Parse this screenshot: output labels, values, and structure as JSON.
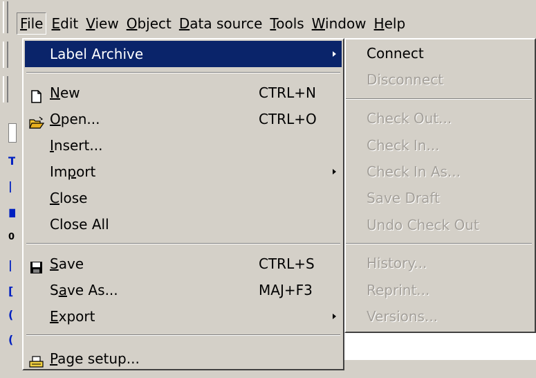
{
  "menubar": {
    "items": [
      {
        "mnemonic": "F",
        "rest": "ile"
      },
      {
        "mnemonic": "E",
        "rest": "dit"
      },
      {
        "mnemonic": "V",
        "rest": "iew"
      },
      {
        "mnemonic": "O",
        "rest": "bject"
      },
      {
        "mnemonic": "D",
        "rest": "ata source"
      },
      {
        "mnemonic": "T",
        "rest": "ools"
      },
      {
        "mnemonic": "W",
        "rest": "indow"
      },
      {
        "mnemonic": "H",
        "rest": "elp"
      }
    ]
  },
  "file_menu": {
    "items": [
      {
        "label": "Label Archive"
      },
      {
        "label_mn": "N",
        "label_rest": "ew",
        "shortcut": "CTRL+N",
        "icon": "new-page-icon"
      },
      {
        "label_mn": "O",
        "label_rest": "pen...",
        "shortcut": "CTRL+O",
        "icon": "open-folder-icon"
      },
      {
        "label_mn": "I",
        "label_rest": "nsert..."
      },
      {
        "label_pre": "Im",
        "label_mn": "p",
        "label_rest": "ort"
      },
      {
        "label_mn": "C",
        "label_rest": "lose"
      },
      {
        "label": "Close All"
      },
      {
        "label_mn": "S",
        "label_rest": "ave",
        "shortcut": "CTRL+S",
        "icon": "save-disk-icon"
      },
      {
        "label_pre": "S",
        "label_mn": "a",
        "label_rest": "ve As...",
        "shortcut": "MAJ+F3"
      },
      {
        "label_mn": "E",
        "label_rest": "xport"
      },
      {
        "label_mn": "P",
        "label_rest": "age setup...",
        "icon": "page-setup-icon"
      }
    ]
  },
  "archive_submenu": {
    "items": [
      {
        "label": "Connect",
        "enabled": true
      },
      {
        "label": "Disconnect",
        "enabled": false
      },
      {
        "label": "Check Out...",
        "enabled": false
      },
      {
        "label": "Check In...",
        "enabled": false
      },
      {
        "label": "Check In As...",
        "enabled": false
      },
      {
        "label": "Save Draft",
        "enabled": false
      },
      {
        "label": "Undo Check Out",
        "enabled": false
      },
      {
        "label": "History...",
        "enabled": false
      },
      {
        "label": "Reprint...",
        "enabled": false
      },
      {
        "label": "Versions...",
        "enabled": false
      }
    ]
  },
  "colors": {
    "face": "#d4d0c8",
    "highlight": "#0a246a",
    "disabled_text": "#a4a09a"
  }
}
